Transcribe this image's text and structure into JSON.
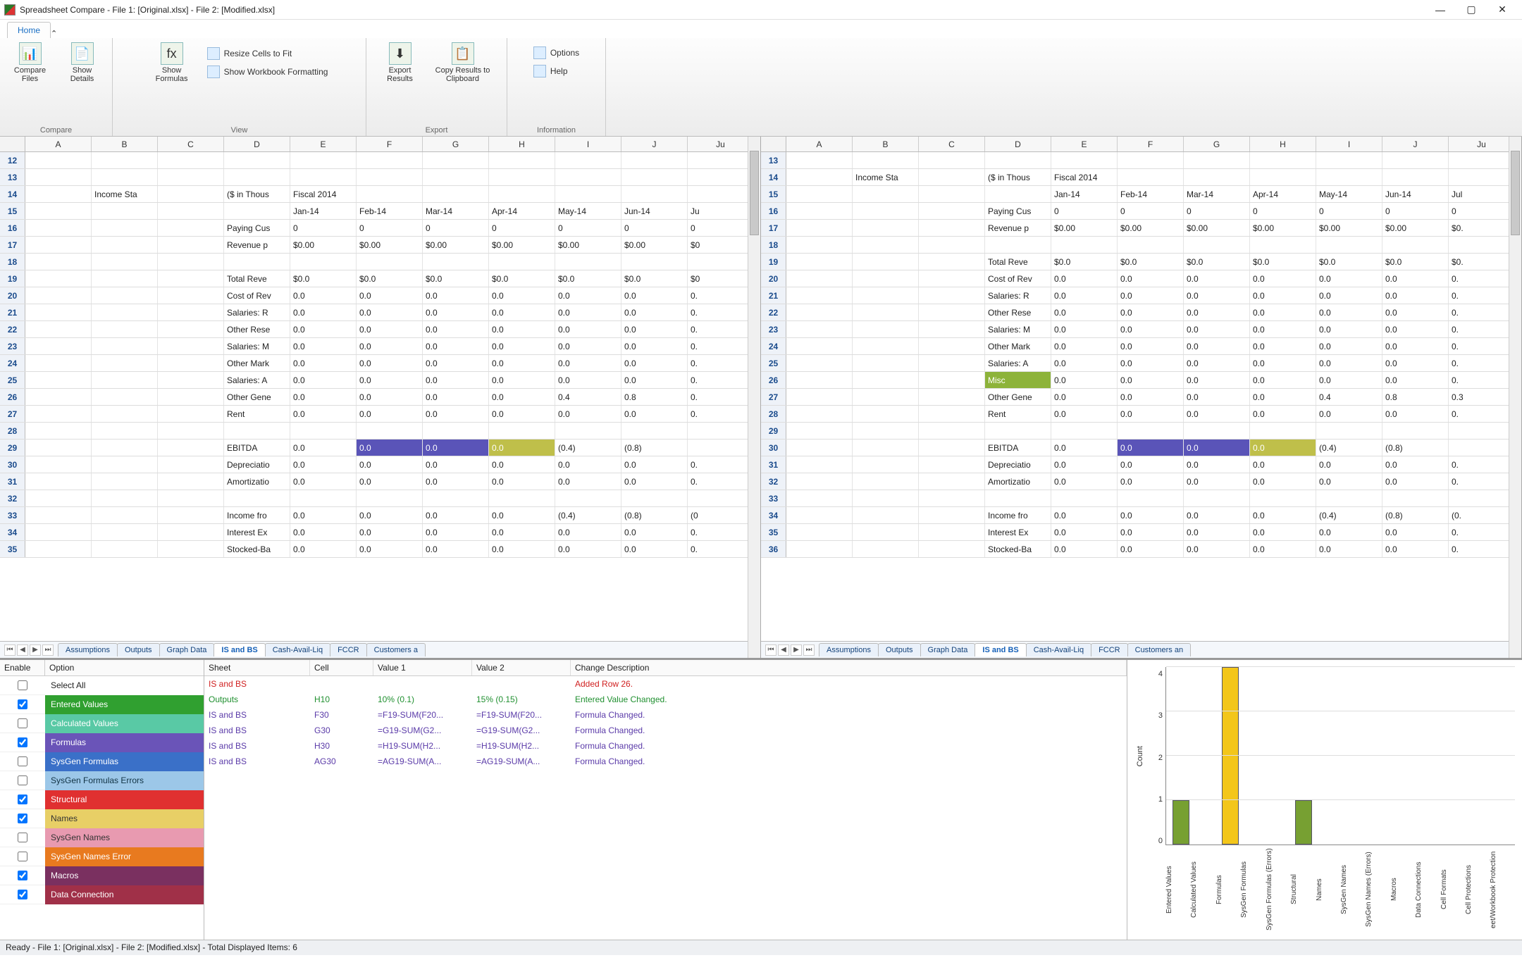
{
  "title": "Spreadsheet Compare - File 1: [Original.xlsx] - File 2: [Modified.xlsx]",
  "ribbon": {
    "tab": "Home",
    "compare_files": "Compare Files",
    "show_details": "Show Details",
    "show_formulas": "Show Formulas",
    "resize_cells": "Resize Cells to Fit",
    "show_formatting": "Show Workbook Formatting",
    "export_results": "Export Results",
    "copy_clipboard": "Copy Results to Clipboard",
    "options": "Options",
    "help": "Help",
    "grp_compare": "Compare",
    "grp_view": "View",
    "grp_export": "Export",
    "grp_info": "Information"
  },
  "columns": [
    "A",
    "B",
    "C",
    "D",
    "E",
    "F",
    "G",
    "H",
    "I",
    "J",
    "Ju"
  ],
  "left": {
    "start_row": 12,
    "rows": [
      {
        "n": 12
      },
      {
        "n": 13
      },
      {
        "n": 14,
        "B": "Income Sta",
        "D": "($ in Thous",
        "E": "Fiscal 2014"
      },
      {
        "n": 15,
        "E": "Jan-14",
        "F": "Feb-14",
        "G": "Mar-14",
        "H": "Apr-14",
        "I": "May-14",
        "J": "Jun-14",
        "K": "Ju"
      },
      {
        "n": 16,
        "D": "Paying Cus",
        "E": "0",
        "F": "0",
        "G": "0",
        "H": "0",
        "I": "0",
        "J": "0",
        "K": "0"
      },
      {
        "n": 17,
        "D": "Revenue p",
        "E": "$0.00",
        "F": "$0.00",
        "G": "$0.00",
        "H": "$0.00",
        "I": "$0.00",
        "J": "$0.00",
        "K": "$0"
      },
      {
        "n": 18
      },
      {
        "n": 19,
        "D": "Total Reve",
        "E": "$0.0",
        "F": "$0.0",
        "G": "$0.0",
        "H": "$0.0",
        "I": "$0.0",
        "J": "$0.0",
        "K": "$0"
      },
      {
        "n": 20,
        "D": "Cost of Rev",
        "E": "0.0",
        "F": "0.0",
        "G": "0.0",
        "H": "0.0",
        "I": "0.0",
        "J": "0.0",
        "K": "0."
      },
      {
        "n": 21,
        "D": "Salaries: R",
        "E": "0.0",
        "F": "0.0",
        "G": "0.0",
        "H": "0.0",
        "I": "0.0",
        "J": "0.0",
        "K": "0."
      },
      {
        "n": 22,
        "D": "Other Rese",
        "E": "0.0",
        "F": "0.0",
        "G": "0.0",
        "H": "0.0",
        "I": "0.0",
        "J": "0.0",
        "K": "0."
      },
      {
        "n": 23,
        "D": "Salaries: M",
        "E": "0.0",
        "F": "0.0",
        "G": "0.0",
        "H": "0.0",
        "I": "0.0",
        "J": "0.0",
        "K": "0."
      },
      {
        "n": 24,
        "D": "Other Mark",
        "E": "0.0",
        "F": "0.0",
        "G": "0.0",
        "H": "0.0",
        "I": "0.0",
        "J": "0.0",
        "K": "0."
      },
      {
        "n": 25,
        "D": "Salaries: A",
        "E": "0.0",
        "F": "0.0",
        "G": "0.0",
        "H": "0.0",
        "I": "0.0",
        "J": "0.0",
        "K": "0."
      },
      {
        "n": 26,
        "D": "Other Gene",
        "E": "0.0",
        "F": "0.0",
        "G": "0.0",
        "H": "0.0",
        "I": "0.4",
        "J": "0.8",
        "K": "0."
      },
      {
        "n": 27,
        "D": "Rent",
        "E": "0.0",
        "F": "0.0",
        "G": "0.0",
        "H": "0.0",
        "I": "0.0",
        "J": "0.0",
        "K": "0."
      },
      {
        "n": 28
      },
      {
        "n": 29,
        "D": "EBITDA",
        "E": "0.0",
        "F": "0.0",
        "G": "0.0",
        "H": "0.0",
        "I": "(0.4)",
        "J": "(0.8)",
        "hl": [
          "F",
          "G",
          "H"
        ]
      },
      {
        "n": 30,
        "D": "Depreciatio",
        "E": "0.0",
        "F": "0.0",
        "G": "0.0",
        "H": "0.0",
        "I": "0.0",
        "J": "0.0",
        "K": "0."
      },
      {
        "n": 31,
        "D": "Amortizatio",
        "E": "0.0",
        "F": "0.0",
        "G": "0.0",
        "H": "0.0",
        "I": "0.0",
        "J": "0.0",
        "K": "0."
      },
      {
        "n": 32
      },
      {
        "n": 33,
        "D": "Income fro",
        "E": "0.0",
        "F": "0.0",
        "G": "0.0",
        "H": "0.0",
        "I": "(0.4)",
        "J": "(0.8)",
        "K": "(0"
      },
      {
        "n": 34,
        "D": "Interest Ex",
        "E": "0.0",
        "F": "0.0",
        "G": "0.0",
        "H": "0.0",
        "I": "0.0",
        "J": "0.0",
        "K": "0."
      },
      {
        "n": 35,
        "D": "Stocked-Ba",
        "E": "0.0",
        "F": "0.0",
        "G": "0.0",
        "H": "0.0",
        "I": "0.0",
        "J": "0.0",
        "K": "0."
      }
    ]
  },
  "right": {
    "start_row": 13,
    "rows": [
      {
        "n": 13
      },
      {
        "n": 14,
        "B": "Income Sta",
        "D": "($ in Thous",
        "E": "Fiscal 2014"
      },
      {
        "n": 15,
        "E": "Jan-14",
        "F": "Feb-14",
        "G": "Mar-14",
        "H": "Apr-14",
        "I": "May-14",
        "J": "Jun-14",
        "K": "Jul"
      },
      {
        "n": 16,
        "D": "Paying Cus",
        "E": "0",
        "F": "0",
        "G": "0",
        "H": "0",
        "I": "0",
        "J": "0",
        "K": "0"
      },
      {
        "n": 17,
        "D": "Revenue p",
        "E": "$0.00",
        "F": "$0.00",
        "G": "$0.00",
        "H": "$0.00",
        "I": "$0.00",
        "J": "$0.00",
        "K": "$0."
      },
      {
        "n": 18
      },
      {
        "n": 19,
        "D": "Total Reve",
        "E": "$0.0",
        "F": "$0.0",
        "G": "$0.0",
        "H": "$0.0",
        "I": "$0.0",
        "J": "$0.0",
        "K": "$0."
      },
      {
        "n": 20,
        "D": "Cost of Rev",
        "E": "0.0",
        "F": "0.0",
        "G": "0.0",
        "H": "0.0",
        "I": "0.0",
        "J": "0.0",
        "K": "0."
      },
      {
        "n": 21,
        "D": "Salaries: R",
        "E": "0.0",
        "F": "0.0",
        "G": "0.0",
        "H": "0.0",
        "I": "0.0",
        "J": "0.0",
        "K": "0."
      },
      {
        "n": 22,
        "D": "Other Rese",
        "E": "0.0",
        "F": "0.0",
        "G": "0.0",
        "H": "0.0",
        "I": "0.0",
        "J": "0.0",
        "K": "0."
      },
      {
        "n": 23,
        "D": "Salaries: M",
        "E": "0.0",
        "F": "0.0",
        "G": "0.0",
        "H": "0.0",
        "I": "0.0",
        "J": "0.0",
        "K": "0."
      },
      {
        "n": 24,
        "D": "Other Mark",
        "E": "0.0",
        "F": "0.0",
        "G": "0.0",
        "H": "0.0",
        "I": "0.0",
        "J": "0.0",
        "K": "0."
      },
      {
        "n": 25,
        "D": "Salaries: A",
        "E": "0.0",
        "F": "0.0",
        "G": "0.0",
        "H": "0.0",
        "I": "0.0",
        "J": "0.0",
        "K": "0."
      },
      {
        "n": 26,
        "D": "Misc",
        "E": "0.0",
        "F": "0.0",
        "G": "0.0",
        "H": "0.0",
        "I": "0.0",
        "J": "0.0",
        "K": "0.",
        "hl_lime": [
          "D"
        ]
      },
      {
        "n": 27,
        "D": "Other Gene",
        "E": "0.0",
        "F": "0.0",
        "G": "0.0",
        "H": "0.0",
        "I": "0.4",
        "J": "0.8",
        "K": "0.3"
      },
      {
        "n": 28,
        "D": "Rent",
        "E": "0.0",
        "F": "0.0",
        "G": "0.0",
        "H": "0.0",
        "I": "0.0",
        "J": "0.0",
        "K": "0."
      },
      {
        "n": 29
      },
      {
        "n": 30,
        "D": "EBITDA",
        "E": "0.0",
        "F": "0.0",
        "G": "0.0",
        "H": "0.0",
        "I": "(0.4)",
        "J": "(0.8)",
        "hl": [
          "F",
          "G",
          "H"
        ]
      },
      {
        "n": 31,
        "D": "Depreciatio",
        "E": "0.0",
        "F": "0.0",
        "G": "0.0",
        "H": "0.0",
        "I": "0.0",
        "J": "0.0",
        "K": "0."
      },
      {
        "n": 32,
        "D": "Amortizatio",
        "E": "0.0",
        "F": "0.0",
        "G": "0.0",
        "H": "0.0",
        "I": "0.0",
        "J": "0.0",
        "K": "0."
      },
      {
        "n": 33
      },
      {
        "n": 34,
        "D": "Income fro",
        "E": "0.0",
        "F": "0.0",
        "G": "0.0",
        "H": "0.0",
        "I": "(0.4)",
        "J": "(0.8)",
        "K": "(0."
      },
      {
        "n": 35,
        "D": "Interest Ex",
        "E": "0.0",
        "F": "0.0",
        "G": "0.0",
        "H": "0.0",
        "I": "0.0",
        "J": "0.0",
        "K": "0."
      },
      {
        "n": 36,
        "D": "Stocked-Ba",
        "E": "0.0",
        "F": "0.0",
        "G": "0.0",
        "H": "0.0",
        "I": "0.0",
        "J": "0.0",
        "K": "0."
      }
    ]
  },
  "sheet_tabs": [
    "Assumptions",
    "Outputs",
    "Graph Data",
    "IS and BS",
    "Cash-Avail-Liq",
    "FCCR",
    "Customers a"
  ],
  "sheet_tabs_right": [
    "Assumptions",
    "Outputs",
    "Graph Data",
    "IS and BS",
    "Cash-Avail-Liq",
    "FCCR",
    "Customers an"
  ],
  "active_tab": "IS and BS",
  "options_panel": {
    "h_enable": "Enable",
    "h_option": "Option",
    "items": [
      {
        "key": "selectall",
        "label": "Select All",
        "checked": false
      },
      {
        "key": "entered",
        "label": "Entered Values",
        "checked": true
      },
      {
        "key": "calc",
        "label": "Calculated Values",
        "checked": false
      },
      {
        "key": "formulas",
        "label": "Formulas",
        "checked": true
      },
      {
        "key": "sysgen",
        "label": "SysGen Formulas",
        "checked": false
      },
      {
        "key": "syserr",
        "label": "SysGen Formulas Errors",
        "checked": false
      },
      {
        "key": "structural",
        "label": "Structural",
        "checked": true
      },
      {
        "key": "names",
        "label": "Names",
        "checked": true
      },
      {
        "key": "sysnames",
        "label": "SysGen Names",
        "checked": false
      },
      {
        "key": "sysnameserr",
        "label": "SysGen Names Error",
        "checked": false
      },
      {
        "key": "macros",
        "label": "Macros",
        "checked": true
      },
      {
        "key": "dataconn",
        "label": "Data Connection",
        "checked": true
      }
    ]
  },
  "diffs": {
    "h_sheet": "Sheet",
    "h_cell": "Cell",
    "h_v1": "Value 1",
    "h_v2": "Value 2",
    "h_desc": "Change Description",
    "rows": [
      {
        "sheet": "IS and BS",
        "cell": "",
        "v1": "",
        "v2": "",
        "desc": "Added Row 26.",
        "color": "red"
      },
      {
        "sheet": "Outputs",
        "cell": "H10",
        "v1": "10% (0.1)",
        "v2": "15% (0.15)",
        "desc": "Entered Value Changed.",
        "color": "green"
      },
      {
        "sheet": "IS and BS",
        "cell": "F30",
        "v1": "=F19-SUM(F20...",
        "v2": "=F19-SUM(F20...",
        "desc": "Formula Changed.",
        "color": "purple"
      },
      {
        "sheet": "IS and BS",
        "cell": "G30",
        "v1": "=G19-SUM(G2...",
        "v2": "=G19-SUM(G2...",
        "desc": "Formula Changed.",
        "color": "purple"
      },
      {
        "sheet": "IS and BS",
        "cell": "H30",
        "v1": "=H19-SUM(H2...",
        "v2": "=H19-SUM(H2...",
        "desc": "Formula Changed.",
        "color": "purple"
      },
      {
        "sheet": "IS and BS",
        "cell": "AG30",
        "v1": "=AG19-SUM(A...",
        "v2": "=AG19-SUM(A...",
        "desc": "Formula Changed.",
        "color": "purple"
      }
    ]
  },
  "status": "Ready - File 1: [Original.xlsx] - File 2: [Modified.xlsx] - Total Displayed Items: 6",
  "chart_data": {
    "type": "bar",
    "ylabel": "Count",
    "ylim": [
      0,
      4
    ],
    "yticks": [
      0,
      1,
      2,
      3,
      4
    ],
    "categories": [
      "Entered Values",
      "Calculated Values",
      "Formulas",
      "SysGen Formulas",
      "SysGen Formulas (Errors)",
      "Structural",
      "Names",
      "SysGen Names",
      "SysGen Names (Errors)",
      "Macros",
      "Data Connections",
      "Cell Formats",
      "Cell Protections",
      "eet/Workbook Protection"
    ],
    "values": [
      1,
      0,
      4,
      0,
      0,
      1,
      0,
      0,
      0,
      0,
      0,
      0,
      0,
      0
    ],
    "colors": [
      "green",
      "",
      "yellow",
      "",
      "",
      "green",
      "",
      "",
      "",
      "",
      "",
      "",
      "",
      ""
    ]
  }
}
